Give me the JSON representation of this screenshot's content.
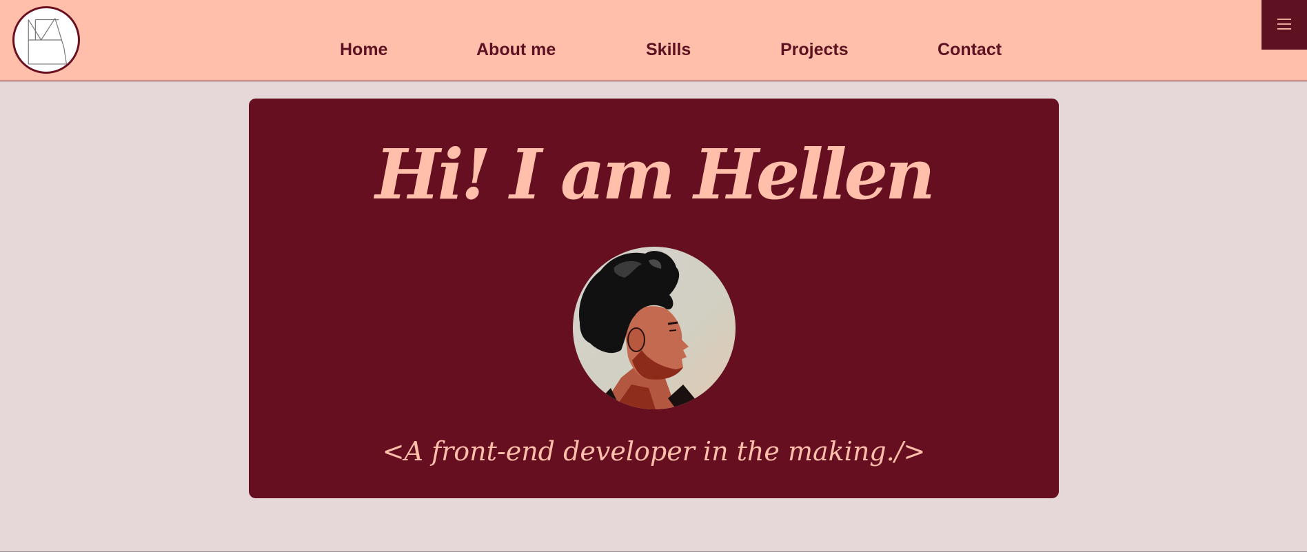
{
  "header": {
    "logo_icon": "monogram-logo-icon",
    "nav": [
      {
        "label": "Home"
      },
      {
        "label": "About me"
      },
      {
        "label": "Skills"
      },
      {
        "label": "Projects"
      },
      {
        "label": "Contact"
      }
    ],
    "menu_icon": "hamburger-menu-icon"
  },
  "hero": {
    "title": "Hi! I am Hellen",
    "avatar_icon": "profile-portrait",
    "tagline": "<A front-end developer in the making./>"
  },
  "colors": {
    "header_bg": "#ffbfab",
    "page_bg": "#e6d7d9",
    "hero_bg": "#650f20",
    "accent_text": "#ffbfab",
    "nav_text": "#5e1120"
  }
}
